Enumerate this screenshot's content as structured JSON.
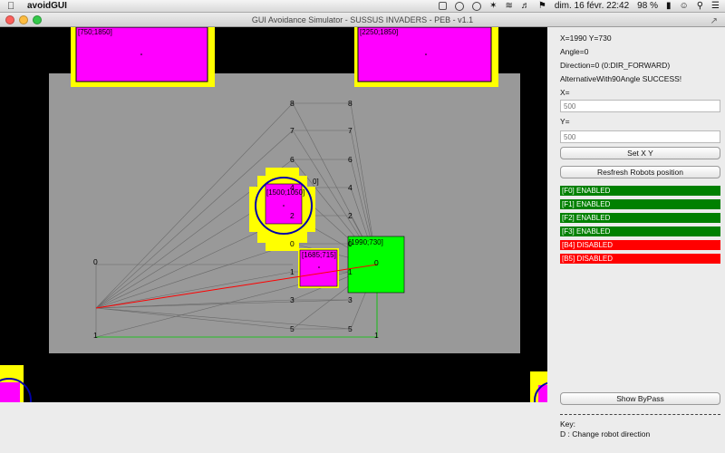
{
  "menubar": {
    "app_name": "avoidGUI",
    "datetime": "dim. 16 févr.  22:42",
    "battery": "98 %"
  },
  "window": {
    "title": "GUI Avoidance Simulator - SUSSUS INVADERS - PEB - v1.1"
  },
  "colors": {
    "table": "#999999",
    "obstacle": "#ff00ff",
    "obstacle_border": "#ffff00",
    "robot": "#00ff00",
    "path": "#ff0000",
    "enabled": "#008000",
    "disabled": "#ff0000",
    "circle": "#0000aa"
  },
  "canvas": {
    "labels": {
      "robot_top_left": "[750;1850]",
      "robot_top_right": "[2250;1850]",
      "robot_center": "[1500;1050]",
      "robot_center_side": "0]",
      "robot_small": "[1685;715]",
      "robot_self": "[1990;730]"
    },
    "node_numbers": {
      "n8a": "8",
      "n8b": "8",
      "n7a": "7",
      "n7b": "7",
      "n6a": "6",
      "n6b": "6",
      "n4a": "4",
      "n4b": "4",
      "n2a": "2",
      "n2b": "2",
      "n0a": "0",
      "n0b": "0",
      "n0c": "0",
      "n1a": "1",
      "n1b": "1",
      "n3a": "3",
      "n3b": "3",
      "n5a": "5",
      "n5b": "5",
      "n1c": "1",
      "n1d": "1",
      "n0robot": "0"
    }
  },
  "panel": {
    "position": "X=1990 Y=730",
    "angle": "Angle=0",
    "direction": "Direction=0 (0:DIR_FORWARD)",
    "message": "AlternativeWith90Angle SUCCESS!",
    "x_label": "X=",
    "x_value": "500",
    "y_label": "Y=",
    "y_value": "500",
    "set_button": "Set X  Y",
    "refresh_button": "Resfresh Robots position",
    "sensors": [
      {
        "label": "[F0] ENABLED",
        "enabled": true
      },
      {
        "label": "[F1] ENABLED",
        "enabled": true
      },
      {
        "label": "[F2] ENABLED",
        "enabled": true
      },
      {
        "label": "[F3] ENABLED",
        "enabled": true
      },
      {
        "label": "[B4] DISABLED",
        "enabled": false
      },
      {
        "label": "[B5] DISABLED",
        "enabled": false
      }
    ],
    "bypass_button": "Show ByPass",
    "key_title": "Key:",
    "key_line": "D : Change robot direction"
  }
}
